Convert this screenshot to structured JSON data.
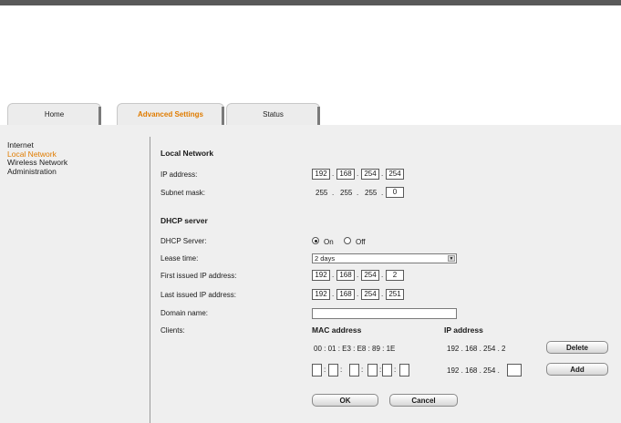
{
  "tabs": [
    {
      "label": "Home"
    },
    {
      "label": "Advanced Settings"
    },
    {
      "label": "Status"
    }
  ],
  "sidebar": {
    "items": [
      {
        "label": "Internet"
      },
      {
        "label": "Local Network"
      },
      {
        "label": "Wireless Network"
      },
      {
        "label": "Administration"
      }
    ]
  },
  "local_network": {
    "title": "Local Network",
    "ip_label": "IP address:",
    "ip": [
      "192",
      "168",
      "254",
      "254"
    ],
    "mask_label": "Subnet mask:",
    "mask_fixed": [
      "255",
      "255",
      "255"
    ],
    "mask_last": "0"
  },
  "dhcp": {
    "title": "DHCP server",
    "server_label": "DHCP Server:",
    "on_label": "On",
    "off_label": "Off",
    "lease_label": "Lease time:",
    "lease_value": "2 days",
    "first_label": "First issued IP address:",
    "first_ip": [
      "192",
      "168",
      "254",
      "2"
    ],
    "last_label": "Last issued IP address:",
    "last_ip": [
      "192",
      "168",
      "254",
      "251"
    ],
    "domain_label": "Domain name:",
    "domain_value": "",
    "clients_label": "Clients:",
    "mac_header": "MAC address",
    "ip_header": "IP address",
    "client": {
      "mac": "00 : 01 : E3 : E8 : 89 : 1E",
      "ip": "192 . 168 . 254 .   2"
    },
    "new_ip_prefix": "192 . 168 . 254 ."
  },
  "buttons": {
    "delete": "Delete",
    "add": "Add",
    "ok": "OK",
    "cancel": "Cancel"
  },
  "colors": {
    "accent": "#e07c00",
    "topbar": "#5a5a5a",
    "panel": "#efefef"
  }
}
